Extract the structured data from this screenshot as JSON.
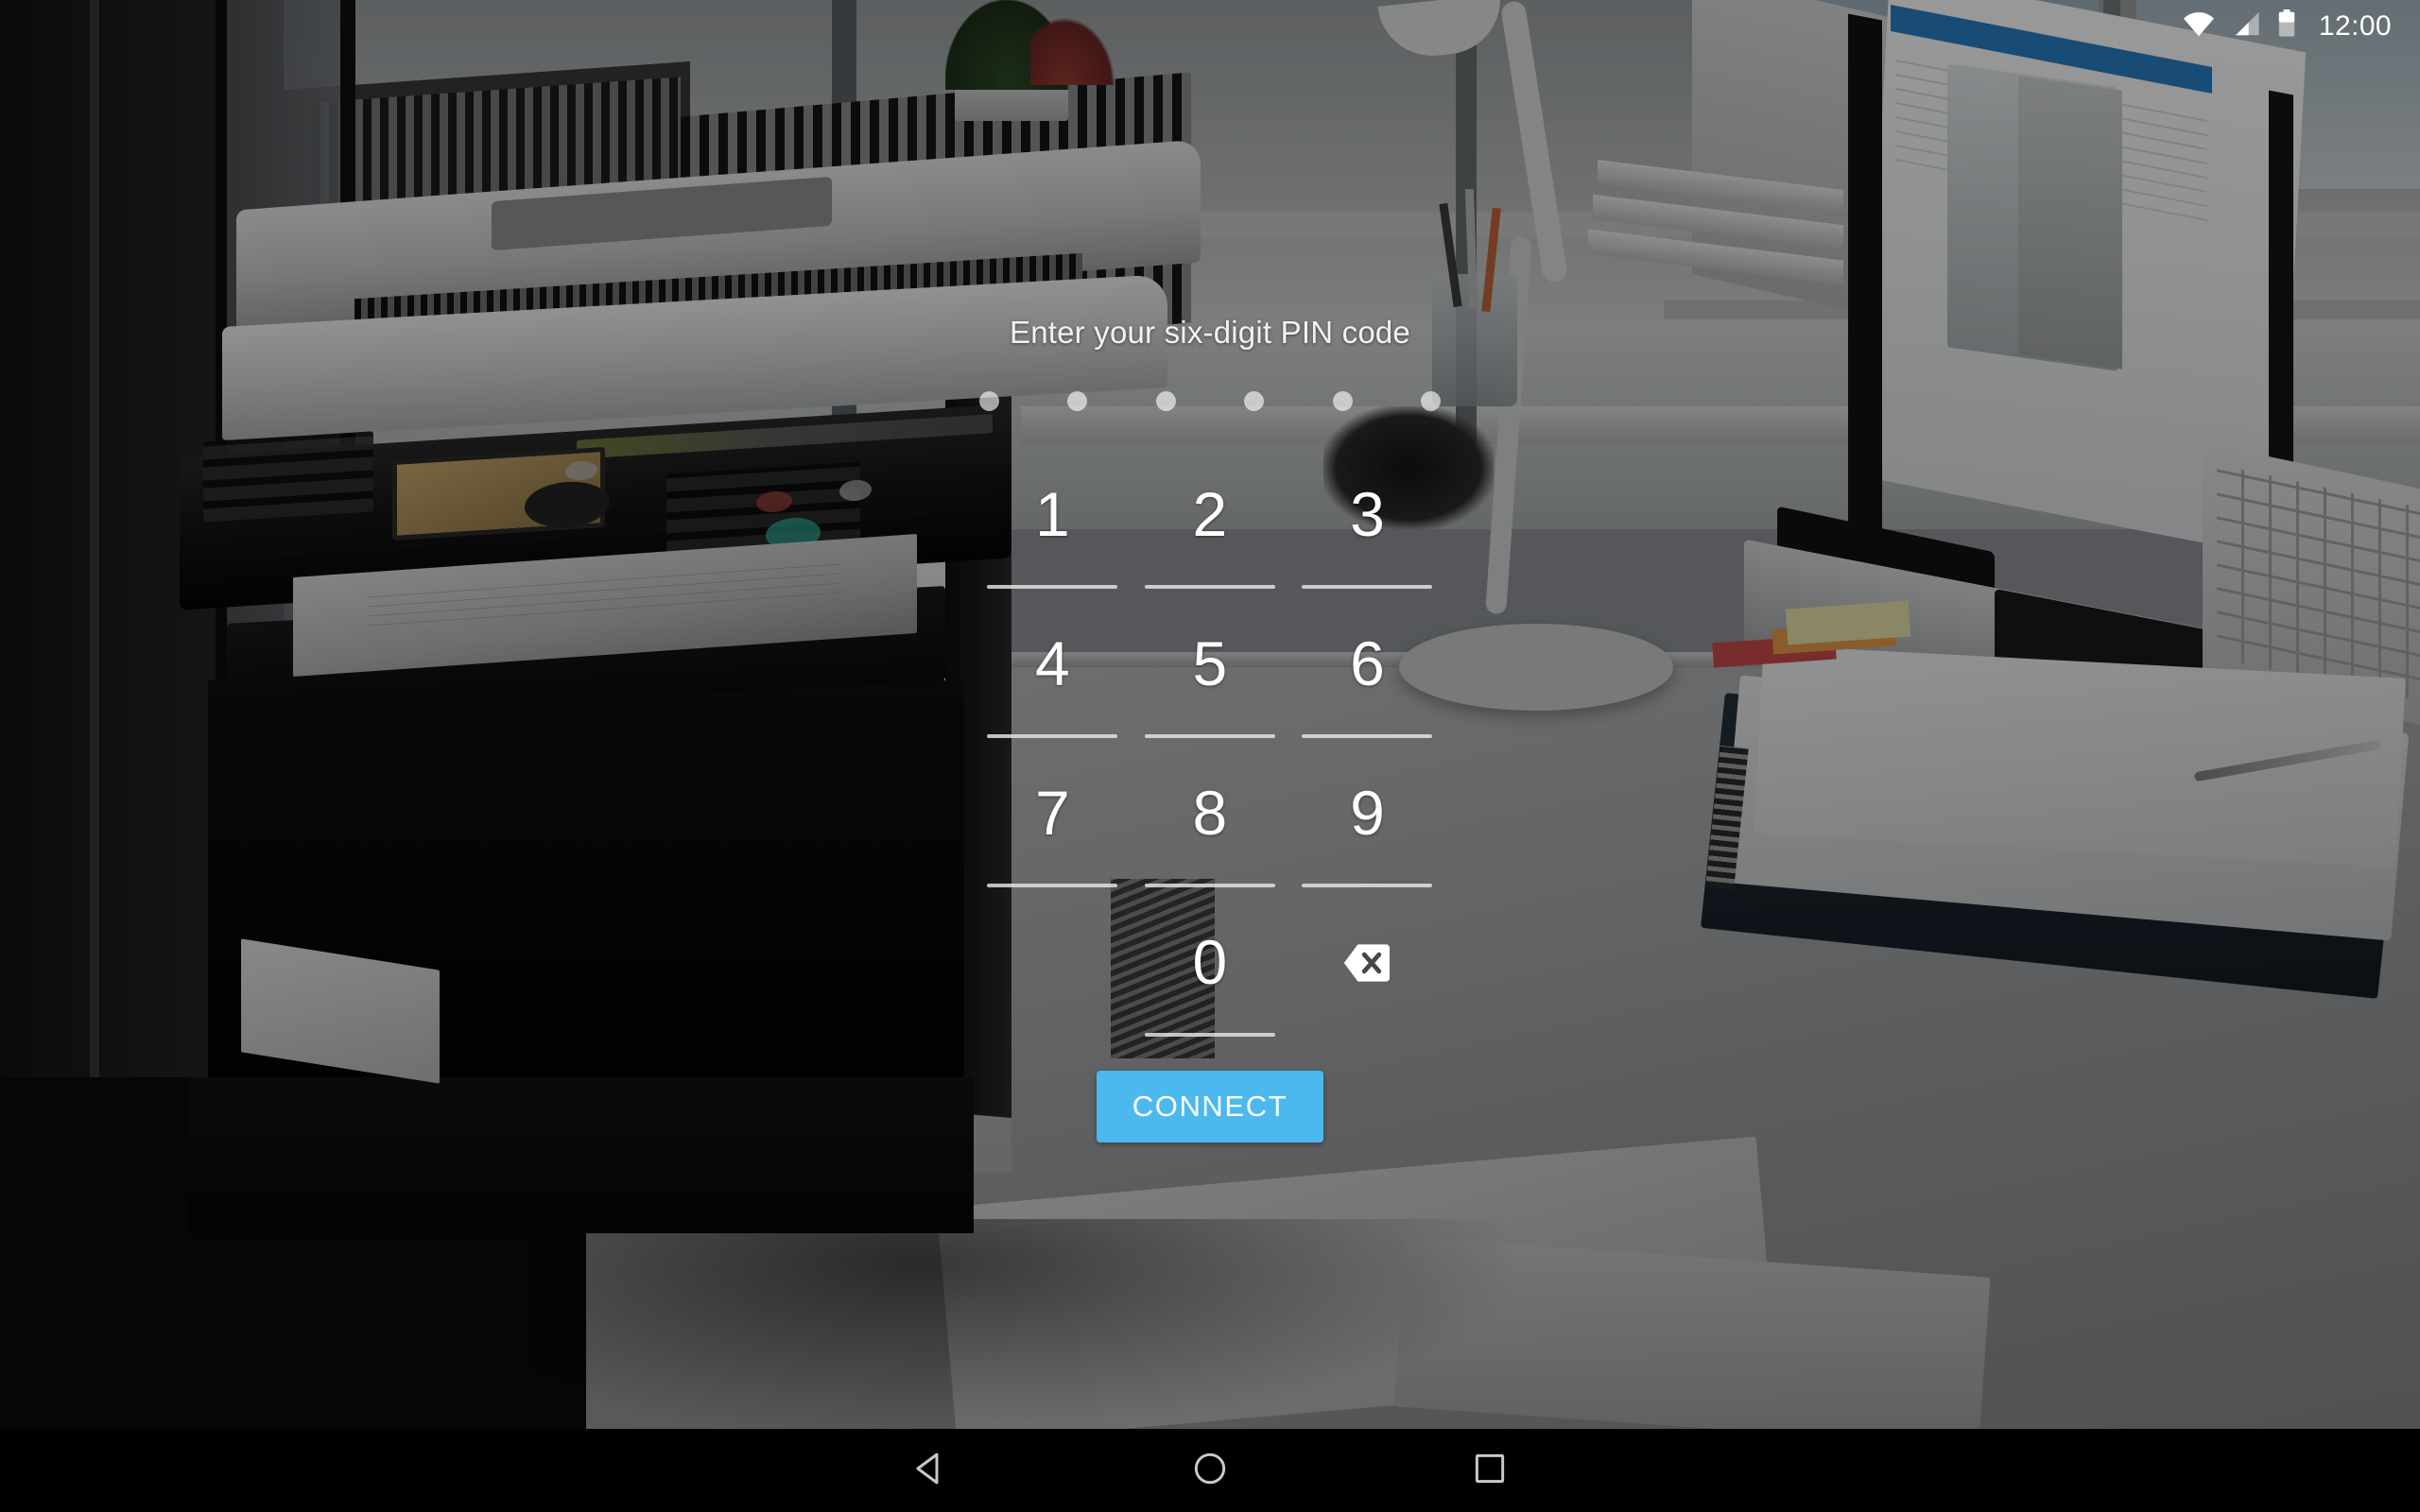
{
  "status_bar": {
    "wifi_icon": "wifi-icon",
    "signal_icon": "cellular-signal-icon",
    "battery_icon": "battery-icon",
    "clock": "12:00"
  },
  "pin_screen": {
    "prompt": "Enter your six-digit PIN code",
    "pin_length": 6,
    "pin_dots": [
      {
        "filled": false
      },
      {
        "filled": false
      },
      {
        "filled": false
      },
      {
        "filled": false
      },
      {
        "filled": false
      },
      {
        "filled": false
      }
    ],
    "entered_value": "",
    "keypad": [
      [
        {
          "label": "1"
        },
        {
          "label": "2"
        },
        {
          "label": "3"
        }
      ],
      [
        {
          "label": "4"
        },
        {
          "label": "5"
        },
        {
          "label": "6"
        }
      ],
      [
        {
          "label": "7"
        },
        {
          "label": "8"
        },
        {
          "label": "9"
        }
      ]
    ],
    "zero_key": {
      "label": "0"
    },
    "backspace_icon": "backspace-icon",
    "connect_label": "CONNECT",
    "accent_color": "#4cb9ee",
    "text_color": "#ffffff"
  },
  "nav_bar": {
    "back_icon": "back-triangle-icon",
    "home_icon": "home-circle-icon",
    "recents_icon": "recents-square-icon",
    "background_color": "#000000"
  },
  "wallpaper": {
    "description": "office-desk-with-printer-photo",
    "overlay_color": "rgba(0,0,0,0.40)"
  }
}
